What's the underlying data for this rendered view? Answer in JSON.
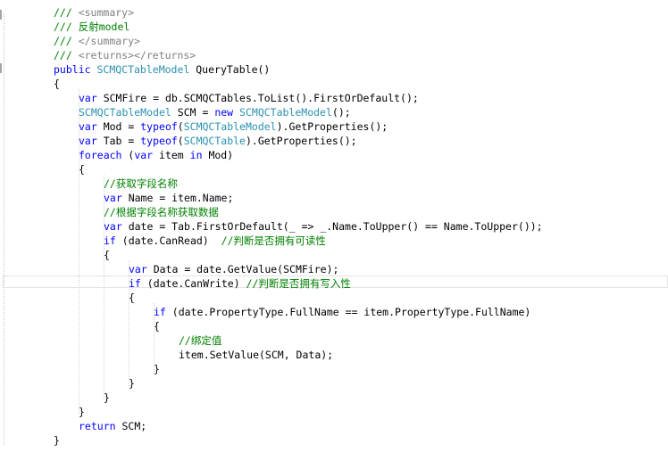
{
  "colors": {
    "comment": "#008000",
    "keyword": "#0000ff",
    "type": "#2b91af",
    "xmldoc": "#808080",
    "text": "#000000"
  },
  "code_editor": {
    "language": "C#",
    "lines": [
      {
        "indent": 0,
        "tokens": [
          {
            "t": "/// ",
            "c": "comment"
          },
          {
            "t": "<summary>",
            "c": "xmldoc"
          }
        ]
      },
      {
        "indent": 0,
        "tokens": [
          {
            "t": "/// 反射model",
            "c": "comment"
          }
        ]
      },
      {
        "indent": 0,
        "tokens": [
          {
            "t": "/// ",
            "c": "comment"
          },
          {
            "t": "</summary>",
            "c": "xmldoc"
          }
        ]
      },
      {
        "indent": 0,
        "tokens": [
          {
            "t": "/// ",
            "c": "comment"
          },
          {
            "t": "<returns></returns>",
            "c": "xmldoc"
          }
        ]
      },
      {
        "indent": 0,
        "tokens": [
          {
            "t": "public ",
            "c": "keyword"
          },
          {
            "t": "SCMQCTableModel",
            "c": "type"
          },
          {
            "t": " QueryTable()",
            "c": "text"
          }
        ]
      },
      {
        "indent": 0,
        "tokens": [
          {
            "t": "{",
            "c": "text"
          }
        ]
      },
      {
        "indent": 1,
        "tokens": [
          {
            "t": "var",
            "c": "keyword"
          },
          {
            "t": " SCMFire = db.SCMQCTables.ToList().FirstOrDefault();",
            "c": "text"
          }
        ]
      },
      {
        "indent": 1,
        "tokens": [
          {
            "t": "SCMQCTableModel",
            "c": "type"
          },
          {
            "t": " SCM = ",
            "c": "text"
          },
          {
            "t": "new",
            "c": "keyword"
          },
          {
            "t": " ",
            "c": "text"
          },
          {
            "t": "SCMQCTableModel",
            "c": "type"
          },
          {
            "t": "();",
            "c": "text"
          }
        ]
      },
      {
        "indent": 1,
        "tokens": [
          {
            "t": "var",
            "c": "keyword"
          },
          {
            "t": " Mod = ",
            "c": "text"
          },
          {
            "t": "typeof",
            "c": "keyword"
          },
          {
            "t": "(",
            "c": "text"
          },
          {
            "t": "SCMQCTableModel",
            "c": "type"
          },
          {
            "t": ").GetProperties();",
            "c": "text"
          }
        ]
      },
      {
        "indent": 1,
        "tokens": [
          {
            "t": "var",
            "c": "keyword"
          },
          {
            "t": " Tab = ",
            "c": "text"
          },
          {
            "t": "typeof",
            "c": "keyword"
          },
          {
            "t": "(",
            "c": "text"
          },
          {
            "t": "SCMQCTable",
            "c": "type"
          },
          {
            "t": ").GetProperties();",
            "c": "text"
          }
        ]
      },
      {
        "indent": 1,
        "tokens": [
          {
            "t": "foreach",
            "c": "keyword"
          },
          {
            "t": " (",
            "c": "text"
          },
          {
            "t": "var",
            "c": "keyword"
          },
          {
            "t": " item ",
            "c": "text"
          },
          {
            "t": "in",
            "c": "keyword"
          },
          {
            "t": " Mod)",
            "c": "text"
          }
        ]
      },
      {
        "indent": 1,
        "tokens": [
          {
            "t": "{",
            "c": "text"
          }
        ]
      },
      {
        "indent": 2,
        "tokens": [
          {
            "t": "//获取字段名称",
            "c": "comment"
          }
        ]
      },
      {
        "indent": 2,
        "tokens": [
          {
            "t": "var",
            "c": "keyword"
          },
          {
            "t": " Name = item.Name;",
            "c": "text"
          }
        ]
      },
      {
        "indent": 2,
        "tokens": [
          {
            "t": "//根据字段名称获取数据",
            "c": "comment"
          }
        ]
      },
      {
        "indent": 2,
        "tokens": [
          {
            "t": "var",
            "c": "keyword"
          },
          {
            "t": " date = Tab.FirstOrDefault(_ => _.Name.ToUpper() == Name.ToUpper());",
            "c": "text"
          }
        ]
      },
      {
        "indent": 2,
        "tokens": [
          {
            "t": "if",
            "c": "keyword"
          },
          {
            "t": " (date.CanRead)  ",
            "c": "text"
          },
          {
            "t": "//判断是否拥有可读性",
            "c": "comment"
          }
        ]
      },
      {
        "indent": 2,
        "tokens": [
          {
            "t": "{",
            "c": "text"
          }
        ]
      },
      {
        "indent": 3,
        "tokens": [
          {
            "t": "var",
            "c": "keyword"
          },
          {
            "t": " Data = date.GetValue(SCMFire);",
            "c": "text"
          }
        ]
      },
      {
        "indent": 3,
        "tokens": [
          {
            "t": "if",
            "c": "keyword"
          },
          {
            "t": " (date.CanWrite) ",
            "c": "text"
          },
          {
            "t": "//判断是否拥有写入性",
            "c": "comment"
          }
        ]
      },
      {
        "indent": 3,
        "tokens": [
          {
            "t": "{",
            "c": "text"
          }
        ]
      },
      {
        "indent": 4,
        "tokens": [
          {
            "t": "if",
            "c": "keyword"
          },
          {
            "t": " (date.PropertyType.FullName == item.PropertyType.FullName)",
            "c": "text"
          }
        ]
      },
      {
        "indent": 4,
        "tokens": [
          {
            "t": "{",
            "c": "text"
          }
        ]
      },
      {
        "indent": 5,
        "tokens": [
          {
            "t": "//绑定值",
            "c": "comment"
          }
        ]
      },
      {
        "indent": 5,
        "tokens": [
          {
            "t": "item.SetValue(SCM, Data);",
            "c": "text"
          }
        ]
      },
      {
        "indent": 4,
        "tokens": [
          {
            "t": "}",
            "c": "text"
          }
        ]
      },
      {
        "indent": 3,
        "tokens": [
          {
            "t": "}",
            "c": "text"
          }
        ]
      },
      {
        "indent": 2,
        "tokens": [
          {
            "t": "}",
            "c": "text"
          }
        ]
      },
      {
        "indent": 1,
        "tokens": [
          {
            "t": "}",
            "c": "text"
          }
        ]
      },
      {
        "indent": 1,
        "tokens": [
          {
            "t": "return",
            "c": "keyword"
          },
          {
            "t": " SCM;",
            "c": "text"
          }
        ]
      },
      {
        "indent": 0,
        "tokens": [
          {
            "t": "}",
            "c": "text"
          }
        ]
      }
    ]
  }
}
